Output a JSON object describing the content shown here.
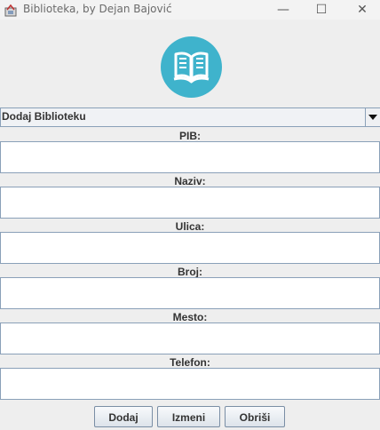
{
  "window": {
    "title": "Biblioteka, by Dejan Bajović",
    "minimize_label": "—",
    "maximize_label": "☐",
    "close_label": "✕"
  },
  "combo": {
    "selected": "Dodaj Biblioteku"
  },
  "fields": [
    {
      "label": "PIB:",
      "value": ""
    },
    {
      "label": "Naziv:",
      "value": ""
    },
    {
      "label": "Ulica:",
      "value": ""
    },
    {
      "label": "Broj:",
      "value": ""
    },
    {
      "label": "Mesto:",
      "value": ""
    },
    {
      "label": "Telefon:",
      "value": ""
    }
  ],
  "buttons": {
    "add": "Dodaj",
    "edit": "Izmeni",
    "delete": "Obriši"
  },
  "colors": {
    "logo_circle": "#3fb3cc",
    "logo_book": "#ffffff"
  }
}
